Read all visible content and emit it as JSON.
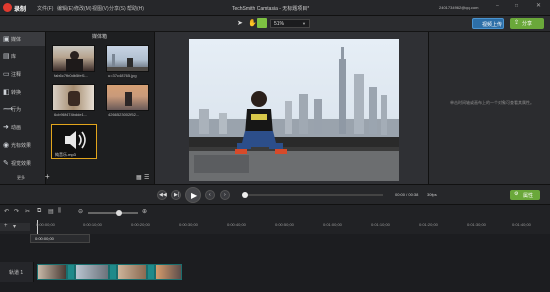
{
  "title_bar": {
    "app_icon_label": "录制",
    "menus": [
      "文件(F)",
      "编辑(E)",
      "修改(M)",
      "视图(V)",
      "分享(S)",
      "帮助(H)"
    ],
    "window_title": "TechSmith Camtasia - 无标题项目*",
    "account": "2401734962@qq.com",
    "upload_label": "视频上传",
    "share_label": "分享"
  },
  "toolbar": {
    "zoom": "51%"
  },
  "left_nav": {
    "items": [
      {
        "label": "媒体",
        "icon": "media-icon"
      },
      {
        "label": "库",
        "icon": "library-icon"
      },
      {
        "label": "注释",
        "icon": "annotation-icon"
      },
      {
        "label": "转换",
        "icon": "transition-icon"
      },
      {
        "label": "行为",
        "icon": "behavior-icon"
      },
      {
        "label": "动画",
        "icon": "animation-icon"
      },
      {
        "label": "光标效果",
        "icon": "cursor-effect-icon"
      },
      {
        "label": "视觉效果",
        "icon": "visual-effect-icon"
      }
    ],
    "more_label": "更多"
  },
  "media_bin": {
    "title": "媒体箱",
    "items": [
      {
        "caption": "fab6c7fb0db5fef1..."
      },
      {
        "caption": "u=37c48765.jpg"
      },
      {
        "caption": "6cb96f474bdde1..."
      },
      {
        "caption": "4266523002f52..."
      },
      {
        "caption": "纯音乐.mp3"
      }
    ]
  },
  "properties": {
    "hint": "单击时间轴或画布上的一个对象可查看其属性。"
  },
  "playback": {
    "time": "00:00 / 00:38",
    "fps": "30fps",
    "properties_label": "属性"
  },
  "timeline": {
    "playhead_time": "0:00:00;00",
    "ticks": [
      "0:00:00;00",
      "0:00:10;00",
      "0:00:20;00",
      "0:00:30;00",
      "0:00:40;00",
      "0:00:50;00",
      "0:01:00;00",
      "0:01:10;00",
      "0:01:20;00",
      "0:01:30;00",
      "0:01:40;00"
    ],
    "track_label": "轨道 1"
  },
  "colors": {
    "accent_green": "#7dc242",
    "accent_blue": "#3b86c6",
    "clip_teal": "#1f8a8a"
  }
}
